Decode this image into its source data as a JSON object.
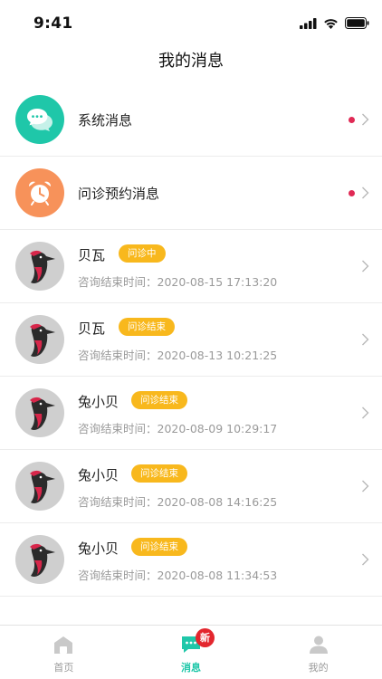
{
  "status_bar": {
    "time": "9:41"
  },
  "header": {
    "title": "我的消息"
  },
  "messages": [
    {
      "type": "system",
      "title": "系统消息",
      "unread": true
    },
    {
      "type": "appointment",
      "title": "问诊预约消息",
      "unread": true
    },
    {
      "type": "chat",
      "name": "贝瓦",
      "badge": "问诊中",
      "sub": "咨询结束时间：2020-08-15 17:13:20"
    },
    {
      "type": "chat",
      "name": "贝瓦",
      "badge": "问诊结束",
      "sub": "咨询结束时间：2020-08-13 10:21:25"
    },
    {
      "type": "chat",
      "name": "兔小贝",
      "badge": "问诊结束",
      "sub": "咨询结束时间：2020-08-09 10:29:17"
    },
    {
      "type": "chat",
      "name": "兔小贝",
      "badge": "问诊结束",
      "sub": "咨询结束时间：2020-08-08 14:16:25"
    },
    {
      "type": "chat",
      "name": "兔小贝",
      "badge": "问诊结束",
      "sub": "咨询结束时间：2020-08-08 11:34:53"
    }
  ],
  "tabs": [
    {
      "label": "首页",
      "icon": "home-icon",
      "active": false
    },
    {
      "label": "消息",
      "icon": "message-icon",
      "active": true,
      "badge": "新"
    },
    {
      "label": "我的",
      "icon": "user-icon",
      "active": false
    }
  ],
  "colors": {
    "accent": "#1fc7a9",
    "badge": "#f8b81d",
    "unread_dot": "#e02a55",
    "appointment": "#f7925a"
  }
}
